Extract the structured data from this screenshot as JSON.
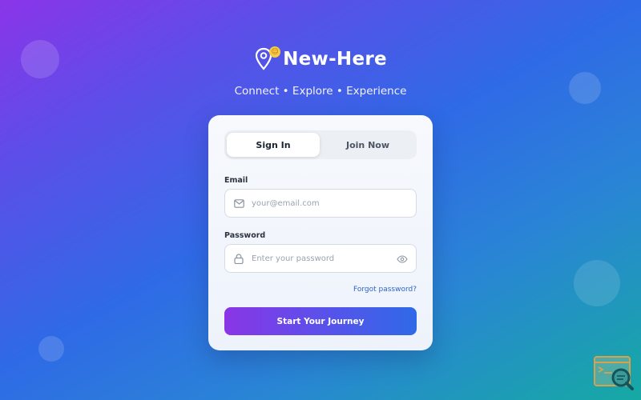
{
  "brand": {
    "name": "New-Here",
    "badge_icon": "smile-badge-icon",
    "logo_icon": "map-pin-icon"
  },
  "tagline": "Connect • Explore • Experience",
  "tabs": [
    {
      "label": "Sign In",
      "active": true
    },
    {
      "label": "Join Now",
      "active": false
    }
  ],
  "form": {
    "email_label": "Email",
    "email_placeholder": "your@email.com",
    "password_label": "Password",
    "password_placeholder": "Enter your password",
    "forgot_label": "Forgot password?",
    "submit_label": "Start Your Journey"
  },
  "colors": {
    "accent_start": "#8a35e6",
    "accent_end": "#2f6ae8",
    "link": "#2e63c9"
  }
}
